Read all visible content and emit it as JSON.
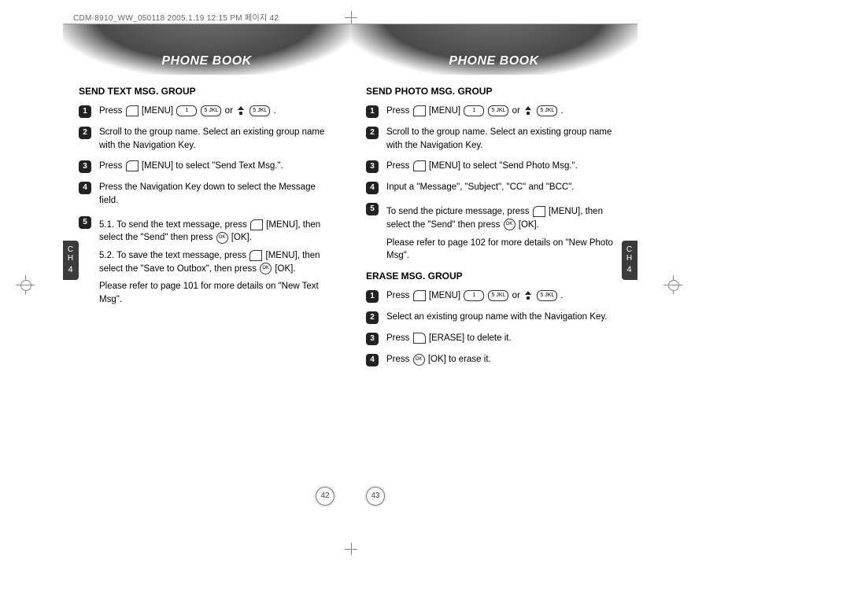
{
  "top_meta": "CDM-8910_WW_050118  2005.1.19  12:15 PM  페이지 42",
  "left_page": {
    "header": "PHONE BOOK",
    "section1_title": "SEND TEXT MSG. GROUP",
    "section1": {
      "s1_pre": "Press",
      "s1_menu": "[MENU]",
      "s1_or": "or",
      "s1_end": ".",
      "s2": "Scroll to the group name. Select an existing group name with the Navigation Key.",
      "s3_pre": "Press",
      "s3_post": "[MENU] to select \"Send Text Msg.\".",
      "s4": "Press the Navigation Key down to select the Message field.",
      "s5a_pre": "5.1. To send the text message, press",
      "s5a_mid": "[MENU], then select the \"Send\" then press",
      "s5a_end": "[OK].",
      "s5b_pre": "5.2. To save the text message, press",
      "s5b_mid": "[MENU], then select the \"Save to Outbox\", then press",
      "s5b_end": "[OK].",
      "note": "Please refer to page 101 for more details on \"New Text Msg\"."
    },
    "ch_label": "C\nH",
    "ch_num": "4",
    "page_num": "42"
  },
  "right_page": {
    "header": "PHONE BOOK",
    "section1_title": "SEND PHOTO MSG. GROUP",
    "section1": {
      "s1_pre": "Press",
      "s1_menu": "[MENU]",
      "s1_or": "or",
      "s1_end": ".",
      "s2": "Scroll to the group name. Select an existing group name with the Navigation Key.",
      "s3_pre": "Press",
      "s3_post": "[MENU] to select \"Send Photo Msg.\".",
      "s4": "Input a \"Message\", \"Subject\", \"CC\" and \"BCC\".",
      "s5_pre": "To send the picture message, press",
      "s5_mid": "[MENU], then select the \"Send\" then press",
      "s5_end": "[OK].",
      "note": "Please refer to page 102 for more details on \"New Photo Msg\"."
    },
    "section2_title": "ERASE MSG. GROUP",
    "section2": {
      "s1_pre": "Press",
      "s1_menu": "[MENU]",
      "s1_or": "or",
      "s1_end": ".",
      "s2": "Select an existing group name with the Navigation Key.",
      "s3_pre": "Press",
      "s3_post": "[ERASE] to delete it.",
      "s4_pre": "Press",
      "s4_post": "[OK] to erase it."
    },
    "ch_label": "C\nH",
    "ch_num": "4",
    "page_num": "43"
  },
  "keys": {
    "onekey": "1",
    "fivekey": "5 JKL"
  }
}
